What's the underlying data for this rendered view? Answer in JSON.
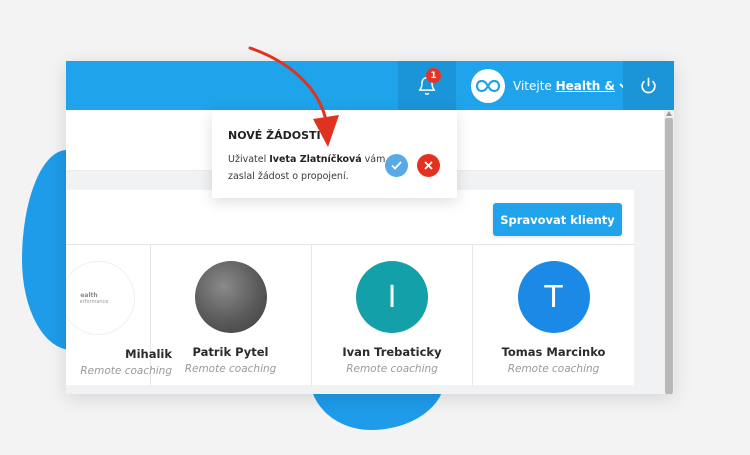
{
  "colors": {
    "brand": "#1fa3ea",
    "brand_dark": "#1b95d8",
    "badge": "#e53324",
    "accept": "#58a9e4",
    "decline": "#e5321f",
    "arrow": "#e0331f"
  },
  "header": {
    "notification_count": "1",
    "welcome_text": "Vitejte",
    "user_name": "Health &",
    "icons": [
      "bell-icon",
      "infinity-logo-icon",
      "chevron-down-icon",
      "power-icon"
    ]
  },
  "notification": {
    "title": "NOVÉ ŽÁDOSTI",
    "msg_prefix": "Uživatel",
    "msg_name": "Iveta Zlatníčková",
    "msg_suffix": "vám zaslal žádost o propojení.",
    "icons": [
      "check-icon",
      "close-icon"
    ]
  },
  "panel": {
    "manage_button": "Spravovat klienty"
  },
  "clients": [
    {
      "name": "Mihalik",
      "role": "Remote coaching",
      "avatar_text": "ealth",
      "avatar_subtext": "erformance"
    },
    {
      "name": "Patrik Pytel",
      "role": "Remote coaching",
      "avatar_text": ""
    },
    {
      "name": "Ivan Trebaticky",
      "role": "Remote coaching",
      "avatar_text": "I",
      "avatar_color": "#13a0a8"
    },
    {
      "name": "Tomas Marcinko",
      "role": "Remote coaching",
      "avatar_text": "T",
      "avatar_color": "#1b8ae6"
    }
  ]
}
